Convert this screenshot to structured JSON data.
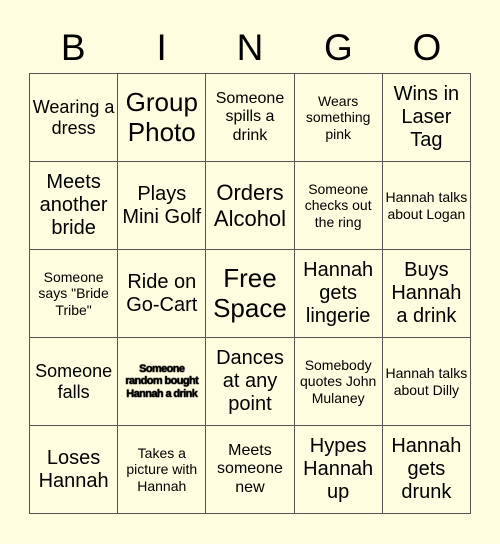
{
  "header": [
    "B",
    "I",
    "N",
    "G",
    "O"
  ],
  "rows": [
    [
      "Wearing a dress",
      "Group Photo",
      "Someone spills a drink",
      "Wears something pink",
      "Wins in Laser Tag"
    ],
    [
      "Meets another bride",
      "Plays Mini Golf",
      "Orders Alcohol",
      "Someone checks out the ring",
      "Hannah talks about Logan"
    ],
    [
      "Someone says \"Bride Tribe\"",
      "Ride on Go-Cart",
      "Free Space",
      "Hannah gets lingerie",
      "Buys Hannah a drink"
    ],
    [
      "Someone falls",
      "Someone random bought Hannah a drink",
      "Dances at any point",
      "Somebody quotes John Mulaney",
      "Hannah talks about Dilly"
    ],
    [
      "Loses Hannah",
      "Takes a picture with Hannah",
      "Meets someone new",
      "Hypes Hannah up",
      "Hannah gets drunk"
    ]
  ]
}
